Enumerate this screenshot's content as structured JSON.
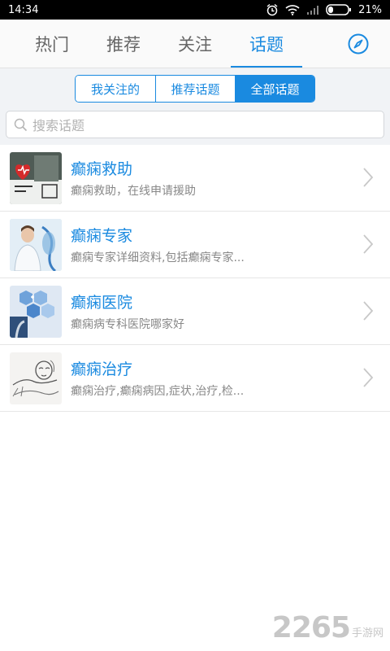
{
  "status_bar": {
    "time": "14:34",
    "battery": "21%"
  },
  "tabs": [
    {
      "label": "热门"
    },
    {
      "label": "推荐"
    },
    {
      "label": "关注"
    },
    {
      "label": "话题"
    }
  ],
  "active_tab": "话题",
  "segments": [
    {
      "label": "我关注的"
    },
    {
      "label": "推荐话题"
    },
    {
      "label": "全部话题"
    }
  ],
  "active_segment": "全部话题",
  "search": {
    "placeholder": "搜索话题"
  },
  "topics": [
    {
      "title": "癫痫救助",
      "desc": "癫痫救助，在线申请援助",
      "icon": "heart-care-image"
    },
    {
      "title": "癫痫专家",
      "desc": "癫痫专家详细资料,包括癫痫专家...",
      "icon": "doctor-image"
    },
    {
      "title": "癫痫医院",
      "desc": "癫痫病专科医院哪家好",
      "icon": "hospital-image"
    },
    {
      "title": "癫痫治疗",
      "desc": "癫痫治疗,癫痫病因,症状,治疗,检...",
      "icon": "sketch-patient-image"
    }
  ],
  "watermark": {
    "number": "2265",
    "suffix": "手游网"
  },
  "colors": {
    "accent": "#1a8ae0",
    "background": "#f1f3f6"
  }
}
